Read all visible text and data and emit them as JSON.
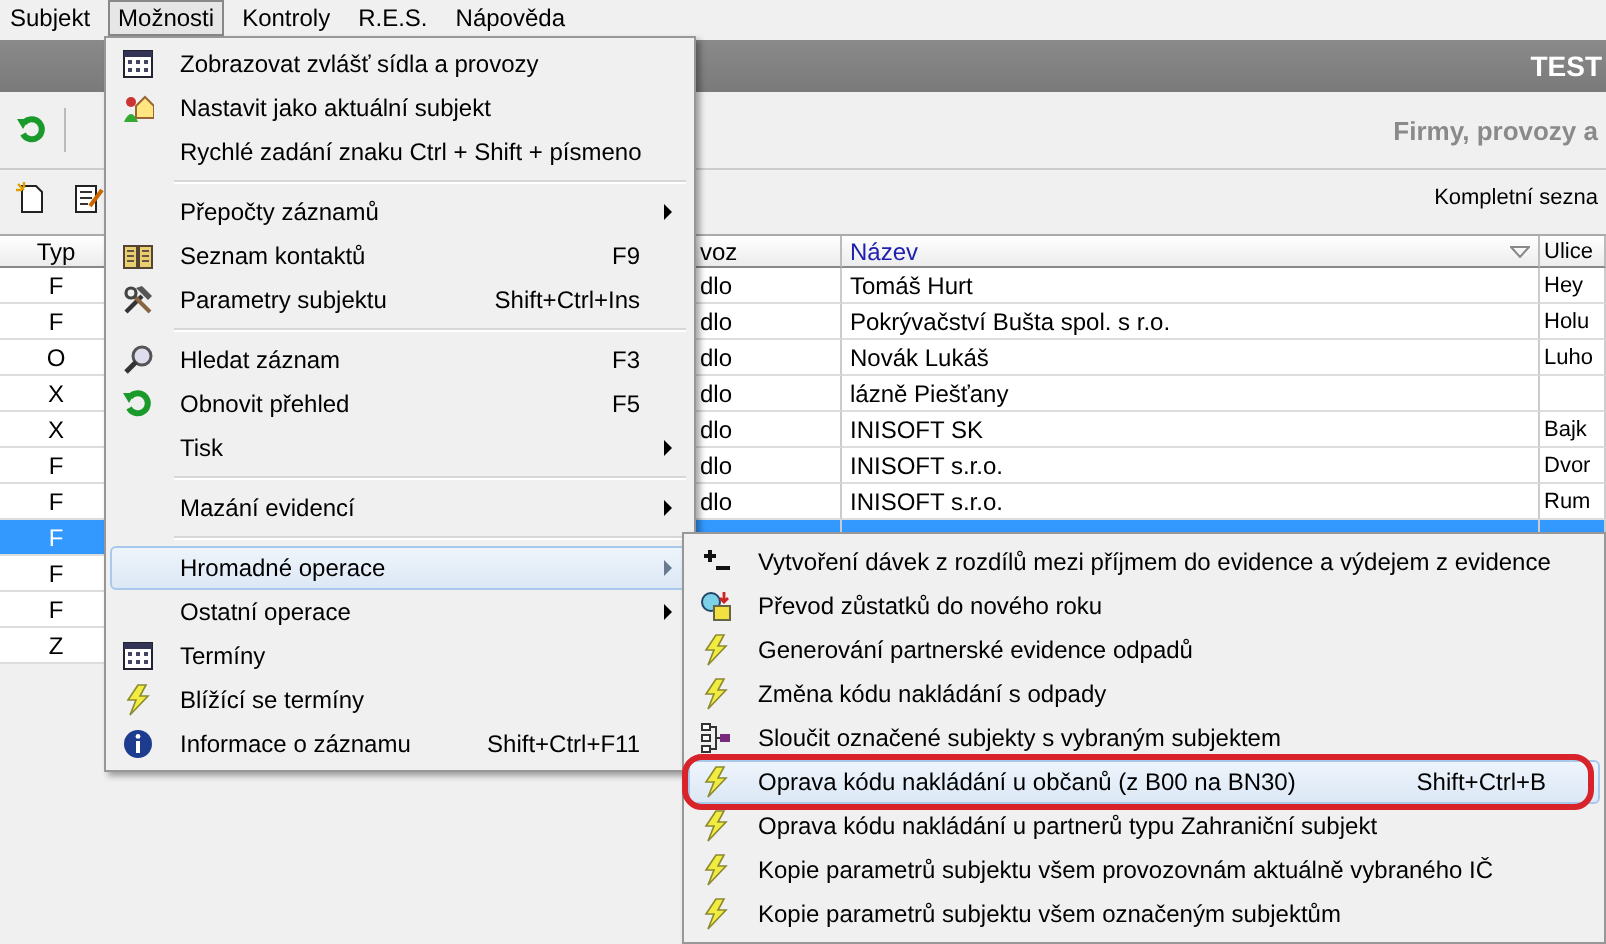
{
  "menubar": [
    {
      "label": "Subjekt",
      "selected": false
    },
    {
      "label": "Možnosti",
      "selected": true
    },
    {
      "label": "Kontroly",
      "selected": false
    },
    {
      "label": "R.E.S.",
      "selected": false
    },
    {
      "label": "Nápověda",
      "selected": false
    }
  ],
  "title_bar": {
    "title": "TEST"
  },
  "header": {
    "subtitle": "Firmy, provozy a",
    "filter_label": "Kompletní sezna"
  },
  "table": {
    "columns": [
      "Typ",
      "voz",
      "Název",
      "Ulice"
    ],
    "rows": [
      {
        "typ": "F",
        "provoz": "dlo",
        "nazev": "Tomáš Hurt",
        "ulice": "Hey",
        "selected": false
      },
      {
        "typ": "F",
        "provoz": "dlo",
        "nazev": "Pokrývačství Bušta spol. s r.o.",
        "ulice": "Holu",
        "selected": false
      },
      {
        "typ": "O",
        "provoz": "dlo",
        "nazev": "Novák Lukáš",
        "ulice": "Luho",
        "selected": false
      },
      {
        "typ": "X",
        "provoz": "dlo",
        "nazev": "lázně Piešťany",
        "selected": false
      },
      {
        "typ": "X",
        "provoz": "dlo",
        "nazev": "INISOFT SK",
        "ulice": "Bajk",
        "selected": false
      },
      {
        "typ": "F",
        "provoz": "dlo",
        "nazev": "INISOFT s.r.o.",
        "ulice": "Dvor",
        "selected": false
      },
      {
        "typ": "F",
        "provoz": "dlo",
        "nazev": "INISOFT s.r.o.",
        "ulice": "Rum",
        "selected": false
      },
      {
        "typ": "F",
        "selected": true
      },
      {
        "typ": "F",
        "selected": false
      },
      {
        "typ": "F",
        "selected": false
      },
      {
        "typ": "Z",
        "selected": false
      }
    ]
  },
  "menu": {
    "items": [
      {
        "kind": "item",
        "label": "Zobrazovat zvlášť sídla a provozy",
        "selected": false,
        "submenu": false
      },
      {
        "kind": "item",
        "label": "Nastavit jako aktuální subjekt",
        "selected": false,
        "submenu": false
      },
      {
        "kind": "item",
        "label": "Rychlé zadání znaku Ctrl + Shift + písmeno",
        "selected": false,
        "submenu": false
      },
      {
        "kind": "separator"
      },
      {
        "kind": "item",
        "label": "Přepočty záznamů",
        "selected": false,
        "submenu": true
      },
      {
        "kind": "item",
        "label": "Seznam kontaktů",
        "shortcut": "F9",
        "selected": false,
        "submenu": false
      },
      {
        "kind": "item",
        "label": "Parametry subjektu",
        "shortcut": "Shift+Ctrl+Ins",
        "selected": false,
        "submenu": false
      },
      {
        "kind": "separator"
      },
      {
        "kind": "item",
        "label": "Hledat záznam",
        "shortcut": "F3",
        "selected": false,
        "submenu": false
      },
      {
        "kind": "item",
        "label": "Obnovit přehled",
        "shortcut": "F5",
        "selected": false,
        "submenu": false
      },
      {
        "kind": "item",
        "label": "Tisk",
        "selected": false,
        "submenu": true
      },
      {
        "kind": "separator"
      },
      {
        "kind": "item",
        "label": "Mazání evidencí",
        "selected": false,
        "submenu": true
      },
      {
        "kind": "separator"
      },
      {
        "kind": "item",
        "label": "Hromadné operace",
        "selected": true,
        "submenu": true
      },
      {
        "kind": "item",
        "label": "Ostatní operace",
        "selected": false,
        "submenu": true
      },
      {
        "kind": "item",
        "label": "Termíny",
        "selected": false,
        "submenu": false
      },
      {
        "kind": "item",
        "label": "Blížící se termíny",
        "selected": false,
        "submenu": false
      },
      {
        "kind": "item",
        "label": "Informace o záznamu",
        "shortcut": "Shift+Ctrl+F11",
        "selected": false,
        "submenu": false
      }
    ]
  },
  "submenu": {
    "items": [
      {
        "label": "Vytvoření dávek z rozdílů mezi příjmem do evidence a výdejem z evidence",
        "selected": false,
        "circled": false
      },
      {
        "label": "Převod zůstatků do nového roku",
        "selected": false,
        "circled": false
      },
      {
        "label": "Generování partnerské evidence odpadů",
        "selected": false,
        "circled": false
      },
      {
        "label": "Změna kódu nakládání s odpady",
        "selected": false,
        "circled": false
      },
      {
        "label": "Sloučit označené subjekty s vybraným subjektem",
        "selected": false,
        "circled": false
      },
      {
        "label": "Oprava kódu nakládání u občanů (z B00 na BN30)",
        "shortcut": "Shift+Ctrl+B",
        "selected": true,
        "circled": true
      },
      {
        "label": "Oprava kódu nakládání u partnerů typu Zahraniční subjekt",
        "selected": false,
        "circled": false
      },
      {
        "label": "Kopie parametrů subjektu všem provozovnám aktuálně vybraného IČ",
        "selected": false,
        "circled": false
      },
      {
        "label": "Kopie parametrů subjektu všem označeným subjektům",
        "selected": false,
        "circled": false
      }
    ]
  }
}
